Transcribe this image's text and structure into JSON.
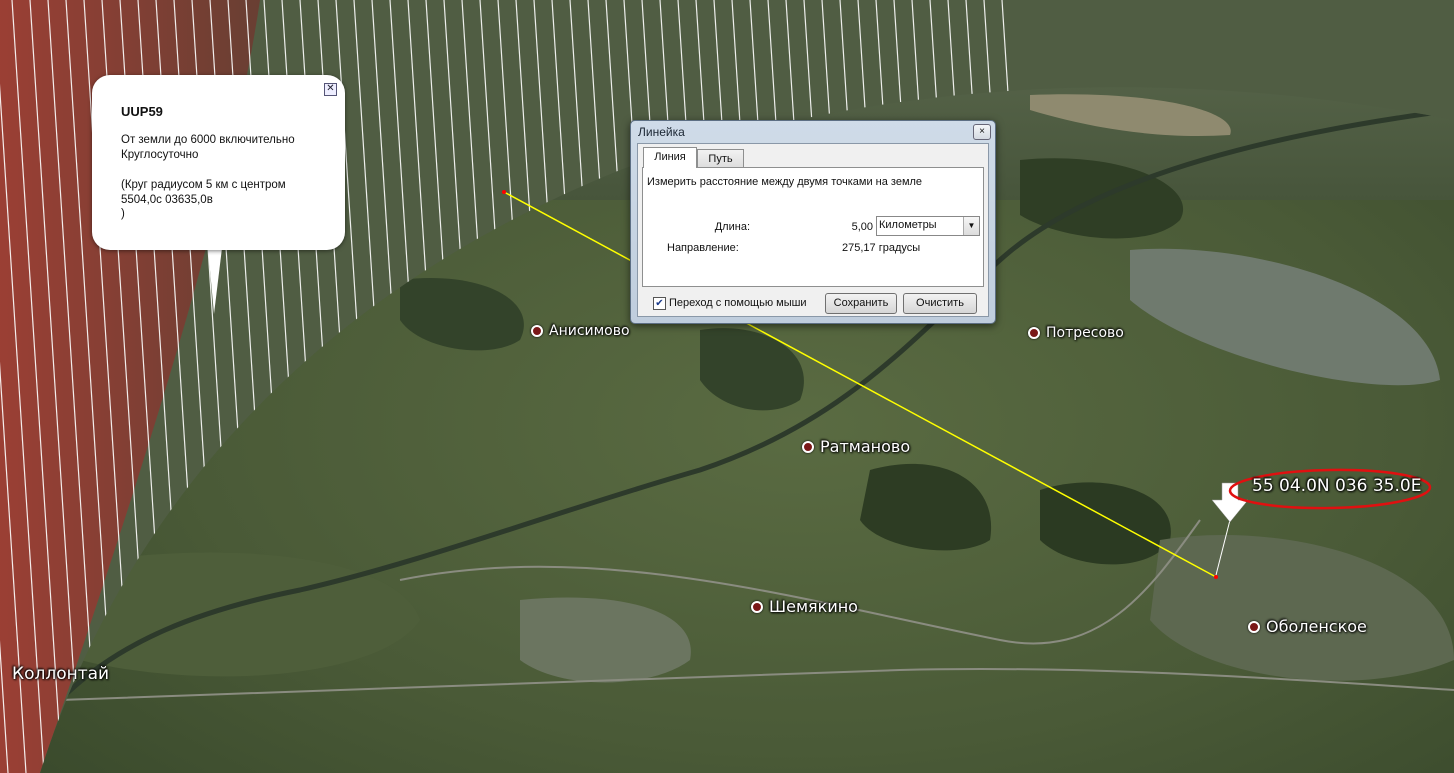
{
  "map": {
    "places": [
      {
        "id": "anisimovo",
        "name": "Анисимово"
      },
      {
        "id": "potresovo",
        "name": "Потресово"
      },
      {
        "id": "ratmanovo",
        "name": "Ратманово"
      },
      {
        "id": "shemyakino",
        "name": "Шемякино"
      },
      {
        "id": "obolenskoe",
        "name": "Оболенское"
      }
    ],
    "kollontai": "Коллонтай",
    "coordinate_label": "55 04.0N 036 35.0E",
    "colors": {
      "annotation": "#e01010",
      "ruler_line": "#ffff00",
      "zone_fill": "#a83a32"
    }
  },
  "balloon": {
    "title": "UUP59",
    "line1": "От земли до 6000 включительно",
    "line2": "Круглосуточно",
    "line3": "(Круг радиусом 5 км с центром",
    "line4": "5504,0с 03635,0в",
    "line5": ")",
    "close_icon": "close-icon"
  },
  "ruler": {
    "title": "Линейка",
    "close": "×",
    "tabs": [
      {
        "label": "Линия"
      },
      {
        "label": "Путь"
      }
    ],
    "description": "Измерить расстояние между двумя точками на земле",
    "length_label": "Длина:",
    "length_value": "5,00",
    "unit": "Километры",
    "direction_label": "Направление:",
    "direction_value": "275,17 градусы",
    "mouse_nav_label": "Переход с помощью мыши",
    "mouse_nav_checked": true,
    "save": "Сохранить",
    "clear": "Очистить"
  }
}
